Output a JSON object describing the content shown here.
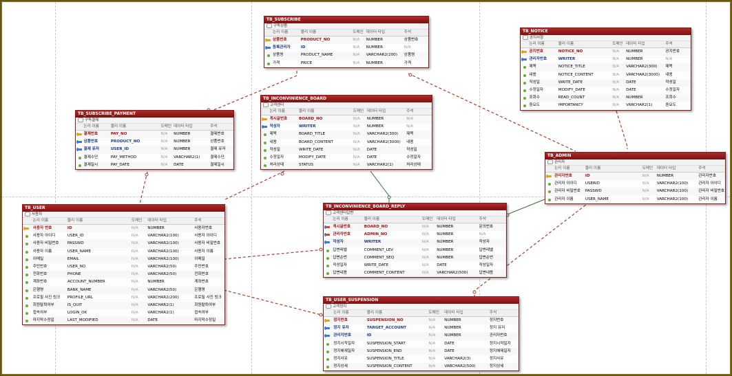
{
  "headers": {
    "logical": "논리 이름",
    "physical": "물리 이름",
    "domain": "도메인",
    "datatype": "데이터 타입",
    "comment": "주석"
  },
  "tables": [
    {
      "key": "subscribe",
      "name": "TB_SUBSCRIBE",
      "comment": "구독상품",
      "columns": [
        {
          "icon": "pk",
          "logical": "상품번호",
          "physical": "PRODUCT_NO",
          "domain": "N/A",
          "type": "NUMBER",
          "comment": "상품번호"
        },
        {
          "icon": "fk",
          "logical": "등록관리자",
          "physical": "ID",
          "domain": "N/A",
          "type": "NUMBER",
          "comment": "N/A"
        },
        {
          "icon": "attr",
          "logical": "상품명",
          "physical": "PRODUCT_NAME",
          "domain": "N/A",
          "type": "VARCHAR2(200)",
          "comment": "상품명"
        },
        {
          "icon": "attr",
          "logical": "가격",
          "physical": "PRICE",
          "domain": "N/A",
          "type": "NUMBER",
          "comment": "가격"
        }
      ]
    },
    {
      "key": "notice",
      "name": "TB_NOTICE",
      "comment": "공지사항",
      "columns": [
        {
          "icon": "pk",
          "logical": "공지번호",
          "physical": "NOTICE_NO",
          "domain": "N/A",
          "type": "NUMBER",
          "comment": "공지번호"
        },
        {
          "icon": "fk",
          "logical": "관리자번호",
          "physical": "WRITER",
          "domain": "N/A",
          "type": "NUMBER",
          "comment": "N/A"
        },
        {
          "icon": "attr",
          "logical": "제목",
          "physical": "NOTICE_TITLE",
          "domain": "N/A",
          "type": "VARCHAR2(300)",
          "comment": "제목"
        },
        {
          "icon": "attr",
          "logical": "내용",
          "physical": "NOTICE_CONTENT",
          "domain": "N/A",
          "type": "VARCHAR2(3000)",
          "comment": "내용"
        },
        {
          "icon": "attr",
          "logical": "작성일",
          "physical": "WRITE_DATE",
          "domain": "N/A",
          "type": "DATE",
          "comment": "작성일"
        },
        {
          "icon": "attr",
          "logical": "수정일자",
          "physical": "MODIFY_DATE",
          "domain": "N/A",
          "type": "DATE",
          "comment": "수정일자"
        },
        {
          "icon": "attr",
          "logical": "조회수",
          "physical": "READ_COUNT",
          "domain": "N/A",
          "type": "NUMBER",
          "comment": "조회수"
        },
        {
          "icon": "attr",
          "logical": "중요도",
          "physical": "IMPORTANCY",
          "domain": "N/A",
          "type": "VARCHAR2(1)",
          "comment": "중요도"
        }
      ]
    },
    {
      "key": "payment",
      "name": "TB_SUBSCRIBE_PAYMENT",
      "comment": "구독결제",
      "columns": [
        {
          "icon": "pk",
          "logical": "결제번호",
          "physical": "PAY_NO",
          "domain": "N/A",
          "type": "NUMBER",
          "comment": "결제번호"
        },
        {
          "icon": "fk",
          "logical": "상품번호",
          "physical": "PRODUCT_NO",
          "domain": "N/A",
          "type": "NUMBER",
          "comment": "상품번호"
        },
        {
          "icon": "fk",
          "logical": "결제 유저",
          "physical": "USER_ID",
          "domain": "N/A",
          "type": "NUMBER",
          "comment": "결제 유저"
        },
        {
          "icon": "attr",
          "logical": "결제수단",
          "physical": "PAY_METHOD",
          "domain": "N/A",
          "type": "VARCHAR2(1)",
          "comment": "결제수단"
        },
        {
          "icon": "attr",
          "logical": "결제일시",
          "physical": "PAY_DATE",
          "domain": "N/A",
          "type": "DATE",
          "comment": "결제일시"
        }
      ]
    },
    {
      "key": "board",
      "name": "TB_INCONVINIENCE_BOARD",
      "comment": "고객센터",
      "columns": [
        {
          "icon": "pk",
          "logical": "게시글번호",
          "physical": "BOARD_NO",
          "domain": "N/A",
          "type": "NUMBER",
          "comment": "N/A"
        },
        {
          "icon": "fk",
          "logical": "작성자",
          "physical": "WRITER",
          "domain": "N/A",
          "type": "NUMBER",
          "comment": "N/A"
        },
        {
          "icon": "attr",
          "logical": "제목",
          "physical": "BOARD_TITLE",
          "domain": "N/A",
          "type": "VARCHAR2(300)",
          "comment": "제목"
        },
        {
          "icon": "attr",
          "logical": "내용",
          "physical": "BOARD_CONTENT",
          "domain": "N/A",
          "type": "VARCHAR2(3000)",
          "comment": "내용"
        },
        {
          "icon": "attr",
          "logical": "작성일",
          "physical": "WRITE_DATE",
          "domain": "N/A",
          "type": "DATE",
          "comment": "작성일"
        },
        {
          "icon": "attr",
          "logical": "수정일자",
          "physical": "MODIFY_DATE",
          "domain": "N/A",
          "type": "DATE",
          "comment": "수정일자"
        },
        {
          "icon": "attr",
          "logical": "처리상태",
          "physical": "STATUS",
          "domain": "N/A",
          "type": "VARCHAR2(1)",
          "comment": "처리상태"
        }
      ]
    },
    {
      "key": "admin",
      "name": "TB_ADMIN",
      "comment": "관리자",
      "columns": [
        {
          "icon": "pk",
          "logical": "관리자번호",
          "physical": "ID",
          "domain": "N/A",
          "type": "NUMBER",
          "comment": "관리자번호"
        },
        {
          "icon": "attr",
          "logical": "관리자 아이디",
          "physical": "USERID",
          "domain": "N/A",
          "type": "VARCHAR2(100)",
          "comment": "관리자 아이디"
        },
        {
          "icon": "attr",
          "logical": "관리자 비밀번호",
          "physical": "PASSWD",
          "domain": "N/A",
          "type": "VARCHAR2(100)",
          "comment": "관리자 비밀번호"
        },
        {
          "icon": "attr",
          "logical": "관리자 이름",
          "physical": "USER_NAME",
          "domain": "N/A",
          "type": "VARCHAR2(100)",
          "comment": "관리자 이름"
        }
      ]
    },
    {
      "key": "user",
      "name": "TB_USER",
      "comment": "사용자",
      "columns": [
        {
          "icon": "pk",
          "logical": "사용자 번호",
          "physical": "ID",
          "domain": "N/A",
          "type": "NUMBER",
          "comment": "사용자번호"
        },
        {
          "icon": "attr",
          "logical": "사용자 아이디",
          "physical": "USER_ID",
          "domain": "N/A",
          "type": "VARCHAR2(100)",
          "comment": "사용자 아이디"
        },
        {
          "icon": "attr",
          "logical": "사용자 비밀번호",
          "physical": "PASSWD",
          "domain": "N/A",
          "type": "VARCHAR2(100)",
          "comment": "사용자 비밀번호"
        },
        {
          "icon": "attr",
          "logical": "사용자 이름",
          "physical": "USER_NAME",
          "domain": "N/A",
          "type": "VARCHAR2(100)",
          "comment": "사용자 이름"
        },
        {
          "icon": "attr",
          "logical": "이메일",
          "physical": "EMAIL",
          "domain": "N/A",
          "type": "VARCHAR2(100)",
          "comment": "이메일"
        },
        {
          "icon": "attr",
          "logical": "주민번호",
          "physical": "USER_NO",
          "domain": "N/A",
          "type": "VARCHAR2(50)",
          "comment": "주민번호"
        },
        {
          "icon": "attr",
          "logical": "전화번호",
          "physical": "PHONE",
          "domain": "N/A",
          "type": "VARCHAR2(50)",
          "comment": "전화번호"
        },
        {
          "icon": "attr",
          "logical": "계좌번호",
          "physical": "ACCOUNT_NUMBER",
          "domain": "N/A",
          "type": "NUMBER",
          "comment": "계좌번호"
        },
        {
          "icon": "attr",
          "logical": "은행명",
          "physical": "BANK_NAME",
          "domain": "N/A",
          "type": "VARCHAR2(50)",
          "comment": "은행명"
        },
        {
          "icon": "attr",
          "logical": "프로필 사진 링크",
          "physical": "PROFILE_URL",
          "domain": "N/A",
          "type": "VARCHAR2(200)",
          "comment": "프로필 사진 링크"
        },
        {
          "icon": "attr",
          "logical": "회원탈퇴여부",
          "physical": "IS_QUIT",
          "domain": "N/A",
          "type": "VARCHAR2(1)",
          "comment": "회원탈퇴여부"
        },
        {
          "icon": "attr",
          "logical": "접속여부",
          "physical": "LOGIN_OK",
          "domain": "N/A",
          "type": "VARCHAR2(1)",
          "comment": "접속여부"
        },
        {
          "icon": "attr",
          "logical": "마지막수정일",
          "physical": "LAST_MODIFIED",
          "domain": "N/A",
          "type": "DATE",
          "comment": "마지막수정일"
        }
      ]
    },
    {
      "key": "reply",
      "name": "TB_INCONVINIENCE_BOARD_REPLY",
      "comment": "고객센터답변",
      "columns": [
        {
          "icon": "pkfk",
          "logical": "게시글번호",
          "physical": "BOARD_NO",
          "domain": "N/A",
          "type": "NUMBER",
          "comment": "문의번호"
        },
        {
          "icon": "pkfk",
          "logical": "관리자번호",
          "physical": "ADMIN_NO",
          "domain": "N/A",
          "type": "NUMBER",
          "comment": "N/A"
        },
        {
          "icon": "fk",
          "logical": "작성자",
          "physical": "WRITER",
          "domain": "N/A",
          "type": "NUMBER",
          "comment": "작성자"
        },
        {
          "icon": "attr",
          "logical": "답변레벨",
          "physical": "COMMENT_LEV",
          "domain": "N/A",
          "type": "NUMBER",
          "comment": "답변레벨"
        },
        {
          "icon": "attr",
          "logical": "답변순번",
          "physical": "COMMENT_SEQ",
          "domain": "N/A",
          "type": "NUMBER",
          "comment": "답변순번"
        },
        {
          "icon": "attr",
          "logical": "작성일자",
          "physical": "WRITE_DATE",
          "domain": "N/A",
          "type": "DATE",
          "comment": "작성일자"
        },
        {
          "icon": "attr",
          "logical": "답변내용",
          "physical": "COMMENT_CONTENT",
          "domain": "N/A",
          "type": "VARCHAR2(500)",
          "comment": "답변내용"
        }
      ]
    },
    {
      "key": "suspension",
      "name": "TB_USER_SUSPENSION",
      "comment": "고객정지",
      "columns": [
        {
          "icon": "pk",
          "logical": "정지번호",
          "physical": "SUSPENSION_NO",
          "domain": "N/A",
          "type": "NUMBER",
          "comment": "정지번호"
        },
        {
          "icon": "fk",
          "logical": "정지 유저",
          "physical": "TARGET_ACCOUNT",
          "domain": "N/A",
          "type": "NUMBER",
          "comment": "정지 유저"
        },
        {
          "icon": "fk",
          "logical": "관리자번호",
          "physical": "ID",
          "domain": "N/A",
          "type": "NUMBER",
          "comment": "관리자번호"
        },
        {
          "icon": "attr",
          "logical": "정지시작일자",
          "physical": "SUSPENSION_START",
          "domain": "N/A",
          "type": "DATE",
          "comment": "정지시작일자"
        },
        {
          "icon": "attr",
          "logical": "정지해제일자",
          "physical": "SUSPENSION_END",
          "domain": "N/A",
          "type": "DATE",
          "comment": "정지해제일자"
        },
        {
          "icon": "attr",
          "logical": "정지사유",
          "physical": "SUSPENSION_TITLE",
          "domain": "N/A",
          "type": "VARCHAR2(3)",
          "comment": "정지사유"
        },
        {
          "icon": "attr",
          "logical": "정지상세",
          "physical": "SUSPENSION_CONTENT",
          "domain": "N/A",
          "type": "VARCHAR2(500)",
          "comment": "정지상세"
        }
      ]
    }
  ],
  "colors": {
    "header": "#8a1a1a",
    "relation_dashed": "#a04030",
    "relation_solid": "#3a6a3a",
    "canvas_border": "#7a6a1a"
  }
}
